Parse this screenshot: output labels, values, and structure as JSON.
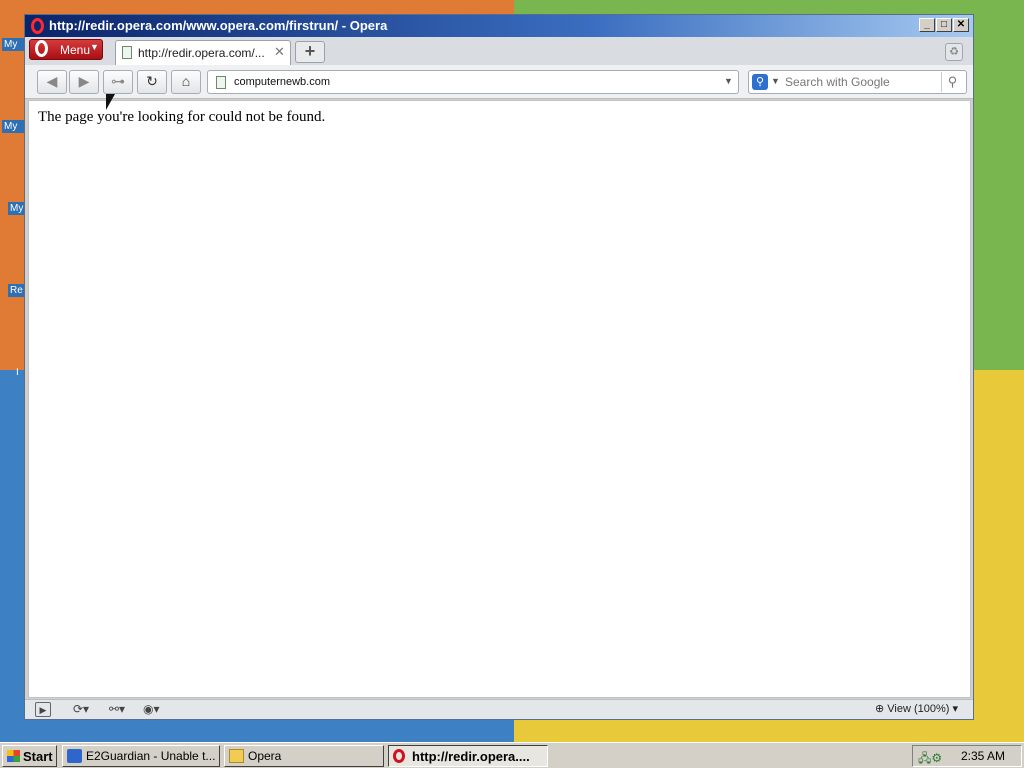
{
  "desktop": {
    "colors": {
      "top_left": "#e07b36",
      "top_right": "#7ab650",
      "bottom_left": "#3d80c4",
      "bottom_right": "#e8c93a"
    },
    "icons": [
      "My",
      "My",
      "My",
      "Re",
      "I"
    ]
  },
  "window": {
    "title": "http://redir.opera.com/www.opera.com/firstrun/ - Opera",
    "controls": {
      "minimize": "_",
      "maximize": "□",
      "close": "✕"
    }
  },
  "tabbar": {
    "menu_label": "Menu",
    "active_tab_title": "http://redir.opera.com/...",
    "new_tab": "+"
  },
  "toolbar": {
    "address": "computernewb.com",
    "search_placeholder": "Search with Google",
    "icons": [
      "back-icon",
      "forward-icon",
      "key-icon",
      "reload-icon",
      "home-icon"
    ]
  },
  "page": {
    "message": "The page you're looking for could not be found."
  },
  "statusbar": {
    "zoom_label": "View (100%)"
  },
  "taskbar": {
    "start_label": "Start",
    "tasks": [
      {
        "label": "E2Guardian - Unable t...",
        "icon": "ie-icon"
      },
      {
        "label": "Opera",
        "icon": "folder-icon"
      },
      {
        "label": "http://redir.opera....",
        "icon": "opera-icon",
        "active": true
      }
    ],
    "clock": "2:35 AM"
  },
  "colors": {
    "title_bar": "#0a246a",
    "opera_red": "#d0121b"
  }
}
